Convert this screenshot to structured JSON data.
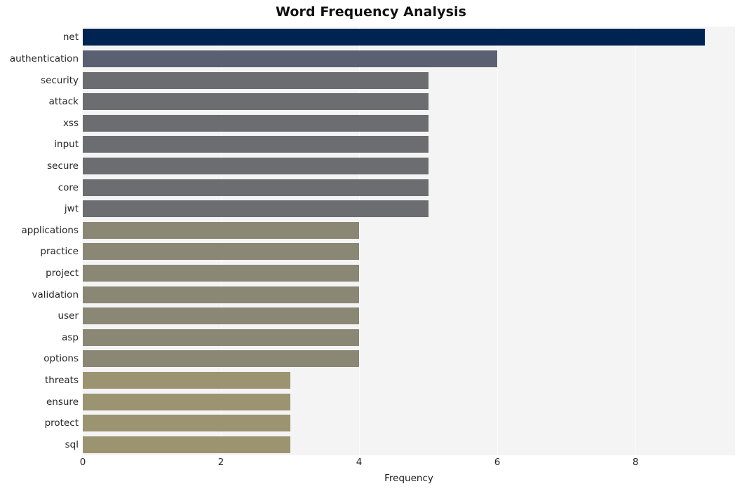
{
  "chart_data": {
    "type": "bar",
    "orientation": "horizontal",
    "title": "Word Frequency Analysis",
    "xlabel": "Frequency",
    "ylabel": "",
    "xlim": [
      0,
      9.44
    ],
    "xticks": [
      0,
      2,
      4,
      6,
      8
    ],
    "xtick_labels": [
      "0",
      "2",
      "4",
      "6",
      "8"
    ],
    "grid": true,
    "grid_axis": "x",
    "legend": false,
    "categories": [
      "net",
      "authentication",
      "security",
      "attack",
      "xss",
      "input",
      "secure",
      "core",
      "jwt",
      "applications",
      "practice",
      "project",
      "validation",
      "user",
      "asp",
      "options",
      "threats",
      "ensure",
      "protect",
      "sql"
    ],
    "values": [
      9,
      6,
      5,
      5,
      5,
      5,
      5,
      5,
      5,
      4,
      4,
      4,
      4,
      4,
      4,
      4,
      3,
      3,
      3,
      3
    ],
    "bar_colors": [
      "#002452",
      "#5a6072",
      "#6c6d71",
      "#6c6d71",
      "#6c6d71",
      "#6c6d71",
      "#6c6d71",
      "#6c6d71",
      "#6c6d71",
      "#8a8775",
      "#8a8775",
      "#8a8775",
      "#8a8775",
      "#8a8775",
      "#8a8775",
      "#8a8775",
      "#9c9471",
      "#9c9471",
      "#9c9471",
      "#9c9471"
    ],
    "plot_background": "#f4f4f5",
    "grid_color": "#fbfbfc",
    "figure_background": "#ffffff"
  }
}
